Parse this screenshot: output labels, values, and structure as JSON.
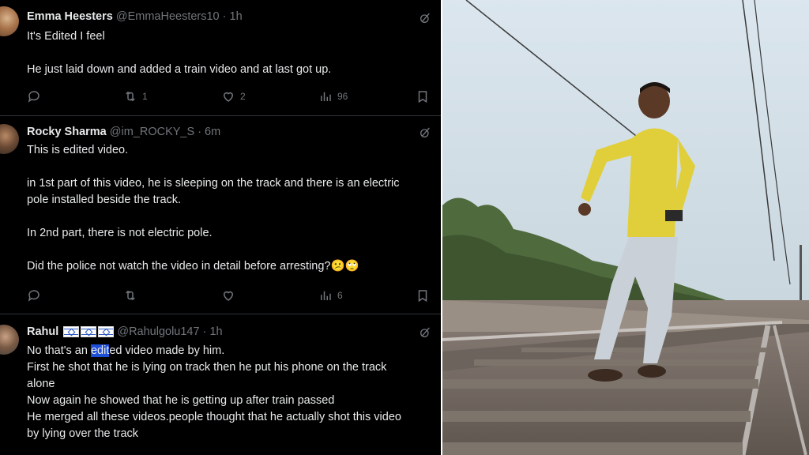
{
  "tweets": [
    {
      "name": "Emma Heesters",
      "handle": "@EmmaHeesters10",
      "time": "· 1h",
      "lines": [
        "It's Edited I feel",
        "",
        "He just laid down and added a train video and at last got up."
      ],
      "replies": "",
      "retweets": "1",
      "likes": "2",
      "views": "96"
    },
    {
      "name": "Rocky Sharma",
      "handle": "@im_ROCKY_S",
      "time": "· 6m",
      "lines": [
        "This is edited video.",
        "",
        "in 1st part of  this video, he is sleeping on the track and there is an electric",
        "pole installed beside the track.",
        "",
        "In 2nd part, there is not electric pole.",
        "",
        "Did the police not watch the video in detail before arresting?"
      ],
      "emoji": "😕🙄",
      "replies": "",
      "retweets": "",
      "likes": "",
      "views": "6"
    },
    {
      "name": "Rahul",
      "handle": "@Rahulgolu147",
      "time": "· 1h",
      "line1_pre": "No that's an ",
      "line1_hl": "edit",
      "line1_post": "ed video made by him.",
      "lines": [
        "First he shot that he is lying on track then he put his phone on the track",
        "alone",
        "Now again he showed that he is getting up after train passed",
        "He merged all these videos.people thought that he actually shot this video",
        "by lying over the track"
      ]
    }
  ],
  "icons": [
    "reply-icon",
    "retweet-icon",
    "like-icon",
    "views-icon",
    "bookmark-icon",
    "grok-icon"
  ],
  "colors": {
    "background": "#000000",
    "text": "#e7e9ea",
    "muted": "#71767b",
    "separator": "#2f3336",
    "highlight": "#1d4ed8"
  }
}
